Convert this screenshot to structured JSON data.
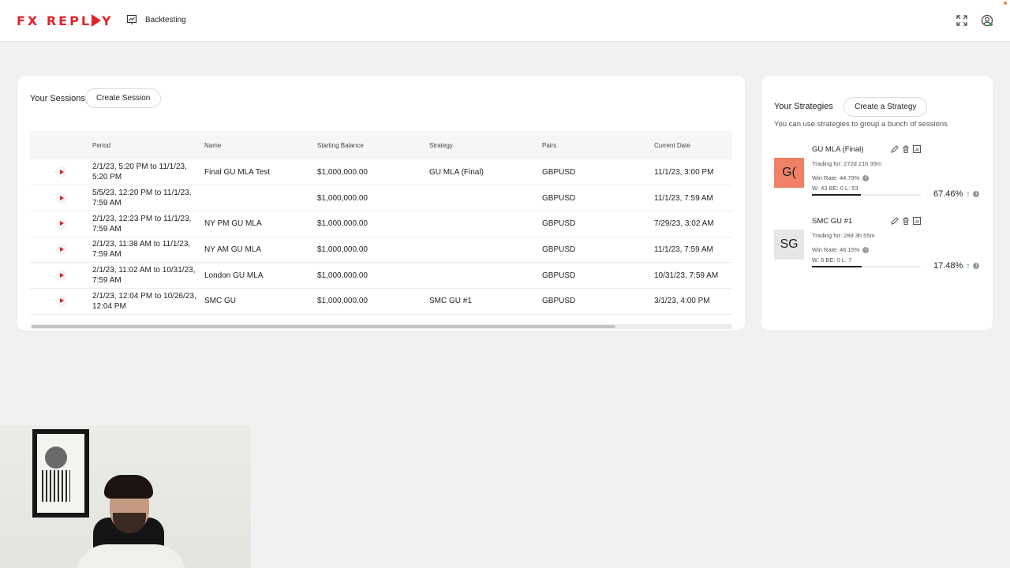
{
  "header": {
    "logo_left": "FX REPL",
    "logo_right": "Y",
    "nav_label": "Backtesting"
  },
  "sessions": {
    "title": "Your Sessions",
    "create_label": "Create Session",
    "columns": [
      "Period",
      "Name",
      "Starting Balance",
      "Strategy",
      "Pairs",
      "Current Date"
    ],
    "rows": [
      {
        "period": "2/1/23, 5:20 PM to 11/1/23, 5:20 PM",
        "name": "Final GU MLA Test",
        "balance": "$1,000,000.00",
        "strategy": "GU MLA (Final)",
        "pair": "GBPUSD",
        "current": "11/1/23, 3:00 PM"
      },
      {
        "period": "5/5/23, 12:20 PM to 11/1/23, 7:59 AM",
        "name": "",
        "balance": "$1,000,000.00",
        "strategy": "",
        "pair": "GBPUSD",
        "current": "11/1/23, 7:59 AM"
      },
      {
        "period": "2/1/23, 12:23 PM to 11/1/23, 7:59 AM",
        "name": "NY PM GU MLA",
        "balance": "$1,000,000.00",
        "strategy": "",
        "pair": "GBPUSD",
        "current": "7/29/23, 3:02 AM"
      },
      {
        "period": "2/1/23, 11:38 AM to 11/1/23, 7:59 AM",
        "name": "NY AM GU MLA",
        "balance": "$1,000,000.00",
        "strategy": "",
        "pair": "GBPUSD",
        "current": "11/1/23, 7:59 AM"
      },
      {
        "period": "2/1/23, 11:02 AM to 10/31/23, 7:59 AM",
        "name": "London GU MLA",
        "balance": "$1,000,000.00",
        "strategy": "",
        "pair": "GBPUSD",
        "current": "10/31/23, 7:59 AM"
      },
      {
        "period": "2/1/23, 12:04 PM to 10/26/23, 12:04 PM",
        "name": "SMC GU",
        "balance": "$1,000,000.00",
        "strategy": "SMC GU #1",
        "pair": "GBPUSD",
        "current": "3/1/23, 4:00 PM"
      }
    ]
  },
  "strategies": {
    "title": "Your Strategies",
    "create_label": "Create a Strategy",
    "subtitle": "You can use strategies to group a bunch of sessions",
    "items": [
      {
        "avatar": "G(",
        "avatar_color": "#f08167",
        "name": "GU MLA (Final)",
        "trading_for": "Trading for: 272d 21h 39m",
        "win_rate": "Win Rate: 44.79%",
        "record": "W: 43 BE: 0 L: 53",
        "pct": "67.46%",
        "progress": 0.45
      },
      {
        "avatar": "SG",
        "avatar_color": "#e6e6e6",
        "name": "SMC GU #1",
        "trading_for": "Trading for: 28d 3h 55m",
        "win_rate": "Win Rate: 46.15%",
        "record": "W: 6 BE: 0 L: 7",
        "pct": "17.48%",
        "progress": 0.46
      }
    ]
  },
  "colors": {
    "brand": "#e2242b",
    "up": "#27a745"
  }
}
